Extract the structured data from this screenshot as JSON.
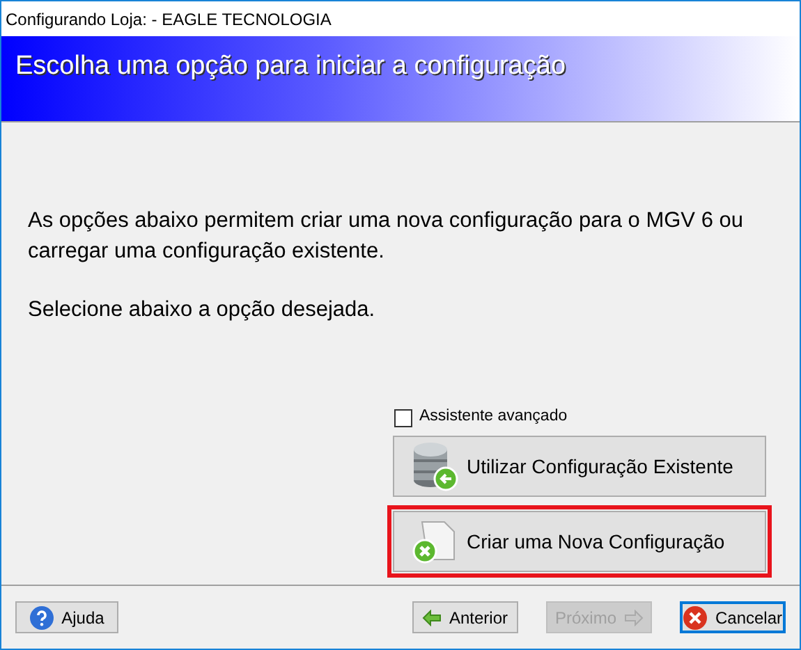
{
  "window": {
    "title": "Configurando Loja:  - EAGLE TECNOLOGIA"
  },
  "banner": {
    "title": "Escolha uma opção para iniciar a configuração"
  },
  "intro": [
    "As opções abaixo permitem criar uma nova configuração para o MGV 6 ou carregar uma configuração existente.",
    "Selecione abaixo a opção desejada."
  ],
  "advanced_checkbox": {
    "label": "Assistente avançado",
    "checked": false
  },
  "options": [
    {
      "kind": "existing",
      "label": "Utilizar Configuração Existente",
      "highlighted": false
    },
    {
      "kind": "new",
      "label": "Criar uma Nova Configuração",
      "highlighted": true
    }
  ],
  "footer": [
    {
      "kind": "help",
      "label": "Ajuda",
      "disabled": false,
      "focused": false
    },
    {
      "kind": "back",
      "label": "Anterior",
      "disabled": false,
      "focused": false
    },
    {
      "kind": "next",
      "label": "Próximo",
      "disabled": true,
      "focused": false
    },
    {
      "kind": "cancel",
      "label": "Cancelar",
      "disabled": false,
      "focused": true
    }
  ]
}
